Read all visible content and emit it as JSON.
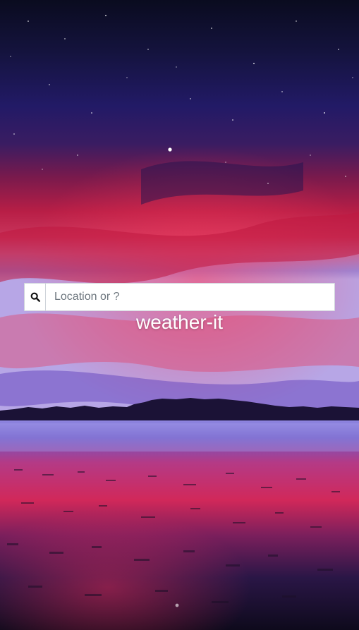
{
  "background": {
    "scene": "night-sky-lake-sunset",
    "colors": {
      "sky_top": "#0b0c24",
      "sky_mid": "#2a1a6b",
      "glow_red": "#d8204a",
      "glow_pink": "#e86aa0",
      "treeline": "#1c1238",
      "water": "#7f6fd6"
    }
  },
  "search": {
    "icon": "search-icon",
    "placeholder": "Location or ?",
    "value": ""
  },
  "app": {
    "title": "weather-it"
  }
}
